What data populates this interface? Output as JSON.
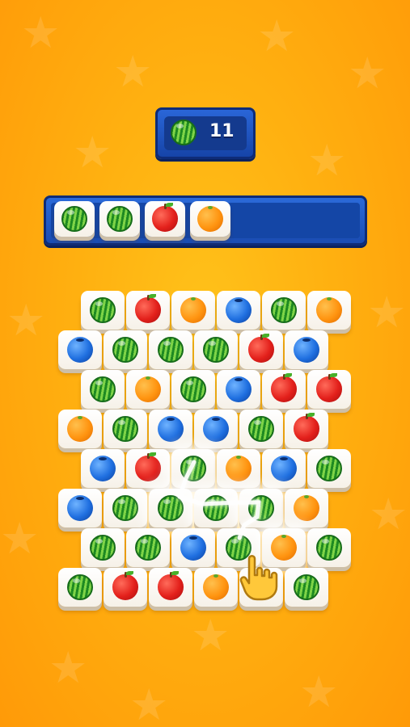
{
  "target": {
    "fruit": "watermelon",
    "count": "11"
  },
  "tray": {
    "slots": [
      "watermelon",
      "watermelon",
      "apple",
      "orange",
      "",
      "",
      ""
    ]
  },
  "board": {
    "rows": [
      [
        "watermelon",
        "apple",
        "orange",
        "blueberry",
        "watermelon",
        "orange"
      ],
      [
        "blueberry",
        "watermelon",
        "watermelon",
        "watermelon",
        "apple",
        "blueberry"
      ],
      [
        "watermelon",
        "orange",
        "watermelon",
        "blueberry",
        "apple",
        "apple"
      ],
      [
        "orange",
        "watermelon",
        "blueberry",
        "blueberry",
        "watermelon",
        "apple"
      ],
      [
        "blueberry",
        "apple",
        "watermelon",
        "orange",
        "blueberry",
        "watermelon"
      ],
      [
        "blueberry",
        "watermelon",
        "watermelon",
        "watermelon",
        "watermelon",
        "orange"
      ],
      [
        "watermelon",
        "watermelon",
        "blueberry",
        "watermelon",
        "orange",
        "watermelon"
      ],
      [
        "watermelon",
        "apple",
        "apple",
        "orange",
        "watermelon",
        "watermelon"
      ]
    ]
  },
  "icons": {
    "hand": "pointing-hand-icon",
    "trail": "swipe-trail"
  },
  "colors": {
    "background": "#ffb010",
    "panel": "#1a4cb2",
    "tile": "#ffffff"
  }
}
